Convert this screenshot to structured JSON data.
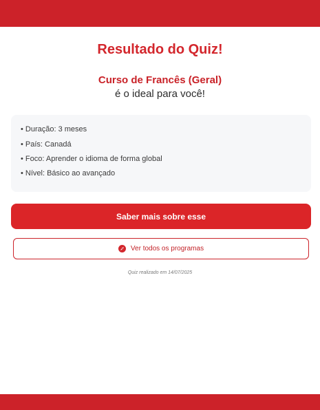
{
  "header": {
    "color": "#cc2229"
  },
  "result": {
    "title": "Resultado do Quiz!",
    "course_name": "Curso de Francês (Geral)",
    "course_sub": "é o ideal para você!"
  },
  "details": [
    "• Duração: 3 meses",
    "• País: Canadá",
    "• Foco: Aprender o idioma de forma global",
    "• Nível: Básico ao avançado"
  ],
  "actions": {
    "primary_label": "Saber mais sobre esse",
    "secondary_label": "Ver todos os programas",
    "secondary_icon": "compass-icon"
  },
  "footer": {
    "quiz_date": "Quiz realizado em 14/07/2025",
    "color": "#cc2229"
  }
}
